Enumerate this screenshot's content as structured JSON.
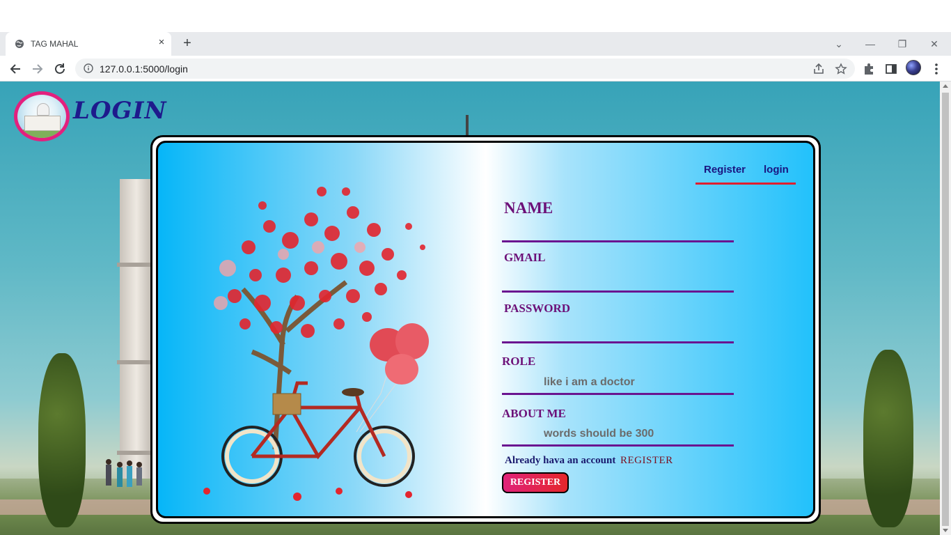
{
  "browser": {
    "tab_title": "TAG MAHAL",
    "url": "127.0.0.1:5000/login"
  },
  "page": {
    "heading": "LOGIN"
  },
  "nav": {
    "register": "Register",
    "login": "login"
  },
  "form": {
    "name_label": "NAME",
    "gmail_label": "GMAIL",
    "password_label": "PASSWORD",
    "role_label": "ROLE",
    "role_placeholder": "like i am a doctor",
    "about_label": "ABOUT ME",
    "about_placeholder": "words should be 300",
    "already_text": "Already hava an account",
    "register_link": "REGISTER",
    "register_button": "REGISTER"
  },
  "colors": {
    "accent_pink": "#e3207e",
    "label_purple": "#6c1078",
    "nav_underline": "#e01e2e"
  }
}
